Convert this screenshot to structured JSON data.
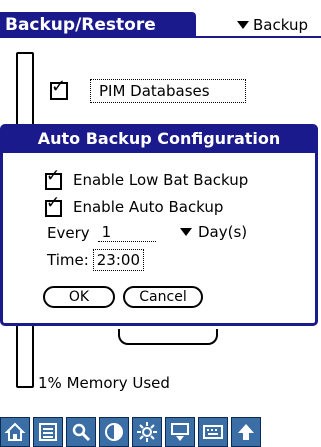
{
  "header": {
    "title": "Backup/Restore",
    "category_label": "Backup"
  },
  "list": {
    "item": "PIM Databases",
    "memory_status": "1% Memory Used"
  },
  "dialog": {
    "title": "Auto Backup Configuration",
    "options": {
      "low_bat": "Enable Low Bat Backup",
      "auto": "Enable Auto Backup"
    },
    "every_label": "Every",
    "every_value": "1",
    "unit_label": "Day(s)",
    "time_label": "Time:",
    "time_value": "23:00",
    "ok_label": "OK",
    "cancel_label": "Cancel"
  },
  "toolbar": {
    "icons": [
      "home-icon",
      "list-icon",
      "search-icon",
      "contrast-icon",
      "brightness-icon",
      "sync-icon",
      "keyboard-icon",
      "up-arrow-icon"
    ]
  },
  "colors": {
    "accent": "#1a1a8c",
    "toolbar": "#3a6ea5"
  }
}
